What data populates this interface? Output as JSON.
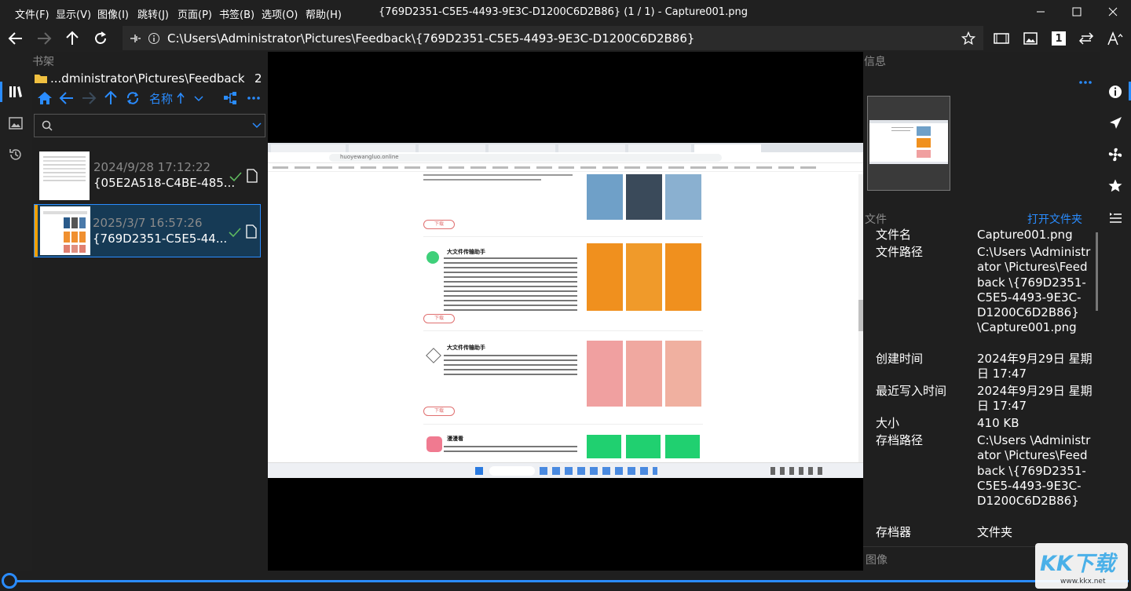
{
  "menu": [
    "文件(F)",
    "显示(V)",
    "图像(I)",
    "跳转(J)",
    "页面(P)",
    "书签(B)",
    "选项(O)",
    "帮助(H)"
  ],
  "window_title": "{769D2351-C5E5-4493-9E3C-D1200C6D2B86} (1 / 1) - Capture001.png",
  "address": {
    "path": "C:\\Users\\Administrator\\Pictures\\Feedback\\{769D2351-C5E5-4493-9E3C-D1200C6D2B86}"
  },
  "toolbar": {
    "page_badge": "1"
  },
  "bookshelf": {
    "title": "书架",
    "folder": "...dministrator\\Pictures\\Feedback",
    "count": "2",
    "sort_label": "名称",
    "search_placeholder": "",
    "items": [
      {
        "date": "2024/9/28 17:12:22",
        "name": "{05E2A518-C4BE-485..."
      },
      {
        "date": "2025/3/7 16:57:26",
        "name": "{769D2351-C5E5-44..."
      }
    ]
  },
  "viewer": {
    "url": "huoyewangluo.online",
    "sections": [
      {
        "title": "大文件传输助手",
        "button": "下载"
      },
      {
        "title": "大文件传输助手",
        "button": "下载"
      },
      {
        "title": "漫漫看",
        "button": "下载"
      }
    ]
  },
  "info": {
    "title": "信息",
    "file_section": "文件",
    "open_folder": "打开文件夹",
    "rows": [
      {
        "label": "文件名",
        "value": "Capture001.png"
      },
      {
        "label": "文件路径",
        "value": "C:\\Users \\Administrator \\Pictures\\Feedback \\{769D2351- C5E5-4493-9E3C- D1200C6D2B86} \\Capture001.png"
      },
      {
        "label": "创建时间",
        "value": "2024年9月29日 星期日 17:47"
      },
      {
        "label": "最近写入时间",
        "value": "2024年9月29日 星期日 17:47"
      },
      {
        "label": "大小",
        "value": "410 KB"
      },
      {
        "label": "存档路径",
        "value": "C:\\Users \\Administrator \\Pictures\\Feedback \\{769D2351- C5E5-4493-9E3C- D1200C6D2B86}"
      },
      {
        "label": "存档器",
        "value": "文件夹"
      }
    ],
    "image_section": "图像"
  },
  "watermark": {
    "text": "KK下载",
    "url": "www.kkx.net"
  },
  "colors": {
    "accent": "#2a8cff",
    "selected_bg": "#163a55",
    "check": "#5fb85f"
  }
}
